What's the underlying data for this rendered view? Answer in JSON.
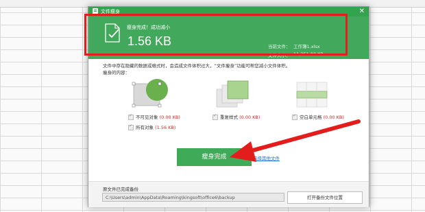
{
  "dialog": {
    "title": "文件瘦身"
  },
  "banner": {
    "status": "瘦身完成！成功减小",
    "saved_size": "1.56 KB",
    "current_file_label": "当前文件：",
    "current_file_value": "工作簿1.xlsx",
    "file_size_label": "文件大小：",
    "file_size_value": "11,251.00 KB"
  },
  "description": {
    "line1": "文件中存在隐藏的数据或格式时，会造成文件体积过大，“文件瘦身”功能可帮您减小文件体积。",
    "line2": "瘦身的内容："
  },
  "options": {
    "invisible_objects": {
      "label": "不可见对象",
      "size": "(0.00 KB)"
    },
    "all_objects": {
      "label": "所有对象",
      "size": "(1.56 KB)"
    },
    "duplicate_styles": {
      "label": "重复样式",
      "size": "(0.00 KB)"
    },
    "empty_cells": {
      "label": "空白单元格",
      "size": "(0.00 KB)"
    }
  },
  "actions": {
    "finish_label": "瘦身完成",
    "choose_other_label": "选择其他文件"
  },
  "footer": {
    "backup_label": "原文件已完成备份",
    "backup_path": "C:\\Users\\admin\\AppData\\Roaming\\kingsoft\\office6\\backup",
    "open_folder_label": "打开备份文件位置"
  },
  "colors": {
    "accent_green": "#42a95c",
    "highlight_red": "#e31c1c",
    "link_blue": "#1d6fd1"
  }
}
